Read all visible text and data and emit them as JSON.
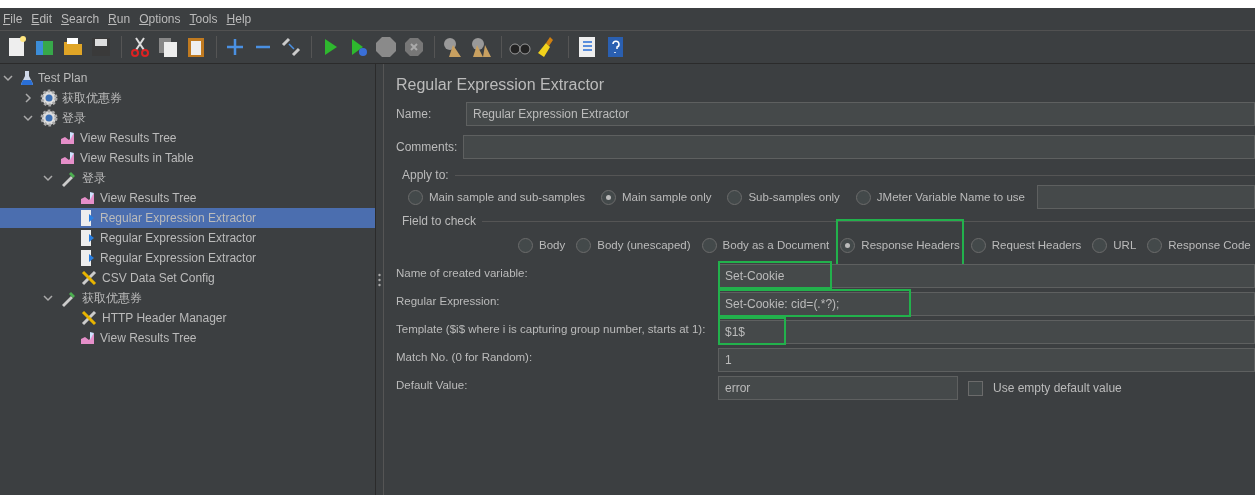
{
  "menu": [
    "File",
    "Edit",
    "Search",
    "Run",
    "Options",
    "Tools",
    "Help"
  ],
  "tree": [
    {
      "label": "Test Plan",
      "kind": "test-plan",
      "expanded": true,
      "selected": false,
      "children": [
        {
          "label": "获取优惠券",
          "kind": "thread-group",
          "expanded": false,
          "selected": false
        },
        {
          "label": "登录",
          "kind": "thread-group",
          "expanded": true,
          "selected": false,
          "children": [
            {
              "label": "View Results Tree",
              "kind": "listener",
              "selected": false
            },
            {
              "label": "View Results in Table",
              "kind": "listener",
              "selected": false
            },
            {
              "label": "登录",
              "kind": "sampler",
              "expanded": true,
              "selected": false,
              "children": [
                {
                  "label": "View Results Tree",
                  "kind": "listener",
                  "selected": false
                },
                {
                  "label": "Regular Expression Extractor",
                  "kind": "extractor",
                  "selected": true
                },
                {
                  "label": "Regular Expression Extractor",
                  "kind": "extractor",
                  "selected": false
                },
                {
                  "label": "Regular Expression Extractor",
                  "kind": "extractor",
                  "selected": false
                },
                {
                  "label": "CSV Data Set Config",
                  "kind": "config",
                  "selected": false
                }
              ]
            },
            {
              "label": "获取优惠券",
              "kind": "sampler",
              "expanded": true,
              "selected": false,
              "children": [
                {
                  "label": "HTTP Header Manager",
                  "kind": "config",
                  "selected": false
                },
                {
                  "label": "View Results Tree",
                  "kind": "listener",
                  "selected": false
                }
              ]
            }
          ]
        }
      ]
    }
  ],
  "editor": {
    "title": "Regular Expression Extractor",
    "name": {
      "label": "Name:",
      "value": "Regular Expression Extractor"
    },
    "comments": {
      "label": "Comments:"
    },
    "apply_to": {
      "legend": "Apply to:",
      "options": [
        {
          "label": "Main sample and sub-samples",
          "selected": false
        },
        {
          "label": "Main sample only",
          "selected": true
        },
        {
          "label": "Sub-samples only",
          "selected": false
        },
        {
          "label": "JMeter Variable Name to use",
          "selected": false
        }
      ]
    },
    "field_to_check": {
      "legend": "Field to check",
      "options": [
        {
          "label": "Body",
          "selected": false,
          "highlighted": false
        },
        {
          "label": "Body (unescaped)",
          "selected": false,
          "highlighted": false
        },
        {
          "label": "Body as a Document",
          "selected": false,
          "highlighted": false
        },
        {
          "label": "Response Headers",
          "selected": true,
          "highlighted": true
        },
        {
          "label": "Request Headers",
          "selected": false,
          "highlighted": false
        },
        {
          "label": "URL",
          "selected": false,
          "highlighted": false
        },
        {
          "label": "Response Code",
          "selected": false,
          "highlighted": false
        }
      ]
    },
    "rows": [
      {
        "kind": "text",
        "label": "Name of created variable:",
        "value": "Set-Cookie",
        "highlighted": true
      },
      {
        "kind": "text",
        "label": "Regular Expression:",
        "value": "Set-Cookie: cid=(.*?);",
        "highlighted": true
      },
      {
        "kind": "text",
        "label": "Template ($i$ where i is capturing group number, starts at 1):",
        "value": "$1$",
        "highlighted": true
      },
      {
        "kind": "text",
        "label": "Match No. (0 for Random):",
        "value": "1",
        "highlighted": false
      },
      {
        "kind": "short",
        "label": "Default Value:",
        "value": "error",
        "highlighted": false,
        "checkbox": {
          "label": "Use empty default value",
          "checked": false
        }
      }
    ]
  }
}
